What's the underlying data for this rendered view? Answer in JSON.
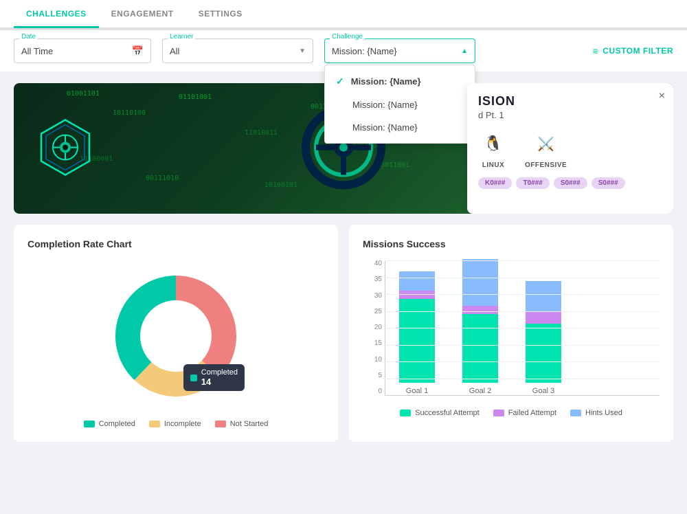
{
  "nav": {
    "tabs": [
      {
        "label": "CHALLENGES",
        "active": true
      },
      {
        "label": "ENGAGEMENT",
        "active": false
      },
      {
        "label": "SETTINGS",
        "active": false
      }
    ]
  },
  "filters": {
    "date": {
      "label": "Date",
      "value": "All Time",
      "placeholder": "All Time"
    },
    "learner": {
      "label": "Learner",
      "value": "All",
      "placeholder": "All"
    },
    "challenge": {
      "label": "Challenge",
      "value": "Mission: {Name}",
      "placeholder": "Mission: {Name}"
    },
    "customFilter": {
      "label": "CusToM FilteR"
    },
    "dropdown": {
      "items": [
        {
          "label": "Mission: {Name}",
          "selected": true
        },
        {
          "label": "Mission: {Name}",
          "selected": false
        },
        {
          "label": "Mission: {Name}",
          "selected": false
        }
      ]
    }
  },
  "challengeCard": {
    "title": "ISION",
    "subtitle": "d Pt. 1",
    "closeLabel": "×",
    "icons": [
      {
        "name": "linux-icon",
        "label": "LINUX",
        "symbol": "🐧"
      },
      {
        "name": "offensive-icon",
        "label": "OFFENSIVE",
        "symbol": "⚔"
      }
    ],
    "tags": [
      "K0###",
      "T0###",
      "S0###",
      "S0###"
    ]
  },
  "completionChart": {
    "title": "Completion Rate Chart",
    "tooltip": {
      "label": "Completed",
      "value": "14"
    },
    "segments": [
      {
        "label": "Completed",
        "color": "#00c9a7",
        "value": 14,
        "percent": 38
      },
      {
        "label": "Incomplete",
        "color": "#f5c97a",
        "value": 9,
        "percent": 25
      },
      {
        "label": "Not Started",
        "color": "#f08080",
        "value": 13,
        "percent": 37
      }
    ]
  },
  "missionsChart": {
    "title": "Missions Success",
    "yLabels": [
      "0",
      "5",
      "10",
      "15",
      "20",
      "25",
      "30",
      "35",
      "40"
    ],
    "groups": [
      {
        "label": "Goal 1",
        "segments": [
          {
            "color": "#00e5b0",
            "height": 140,
            "value": 25
          },
          {
            "color": "#cc88ee",
            "height": 14,
            "value": 2.5
          },
          {
            "color": "#88bbff",
            "height": 28,
            "value": 5
          }
        ]
      },
      {
        "label": "Goal 2",
        "segments": [
          {
            "color": "#00e5b0",
            "height": 115,
            "value": 20.5
          },
          {
            "color": "#cc88ee",
            "height": 14,
            "value": 2.5
          },
          {
            "color": "#88bbff",
            "height": 80,
            "value": 14
          }
        ]
      },
      {
        "label": "Goal 3",
        "segments": [
          {
            "color": "#00e5b0",
            "height": 98,
            "value": 17.5
          },
          {
            "color": "#cc88ee",
            "height": 22,
            "value": 4
          },
          {
            "color": "#88bbff",
            "height": 50,
            "value": 9
          }
        ]
      }
    ],
    "legend": [
      {
        "label": "Successful Attempt",
        "color": "#00e5b0"
      },
      {
        "label": "Failed Attempt",
        "color": "#cc88ee"
      },
      {
        "label": "Hints Used",
        "color": "#88bbff"
      }
    ]
  }
}
